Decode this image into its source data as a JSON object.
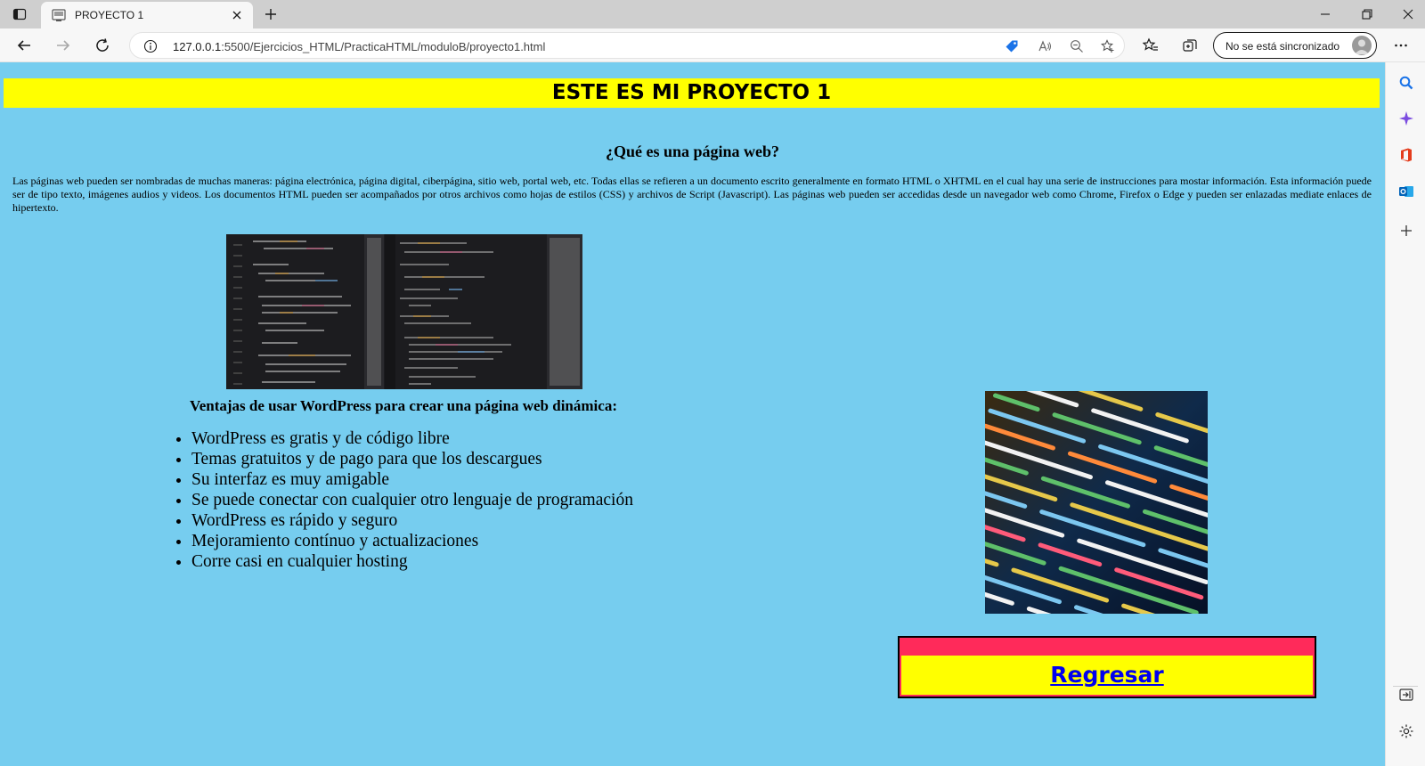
{
  "browser": {
    "tab": {
      "title": "PROYECTO 1"
    },
    "address": {
      "host": "127.0.0.1",
      "path": ":5500/Ejercicios_HTML/PracticaHTML/moduloB/proyecto1.html"
    },
    "sync_button": {
      "label": "No se está sincronizado"
    },
    "icons": {
      "sidebar_toggle": "sidebar-toggle-icon",
      "favicon": "page-favicon-icon",
      "close_tab": "close-icon",
      "new_tab": "plus-icon",
      "minimize": "minimize-icon",
      "restore": "restore-icon",
      "close_window": "close-icon",
      "back": "arrow-left-icon",
      "forward": "arrow-right-icon",
      "refresh": "refresh-icon",
      "site_info": "info-icon",
      "shopping": "tag-icon",
      "read_aloud": "read-aloud-icon",
      "zoom": "zoom-out-icon",
      "add_favorite": "star-plus-icon",
      "favorites": "favorites-icon",
      "collections": "collections-icon",
      "more": "more-icon"
    }
  },
  "edge_sidebar": {
    "icons": [
      "search-icon",
      "copilot-icon",
      "office-icon",
      "outlook-icon",
      "plus-icon",
      "sidebar-expand-icon",
      "settings-icon"
    ]
  },
  "page": {
    "heading": "ESTE ES MI PROYECTO 1",
    "section_title": "¿Qué es una página web?",
    "intro": "Las páginas web pueden ser nombradas de muchas maneras: página electrónica, página digital, ciberpágina, sitio web, portal web, etc. Todas ellas se refieren a un documento escrito generalmente en formato HTML o XHTML en el cual hay una serie de instrucciones para mostar información. Esta información puede ser de tipo texto, imágenes audios y videos. Los documentos HTML pueden ser acompañados por otros archivos como hojas de estilos (CSS) y archivos de Script (Javascript). Las páginas web pueden ser accedidas desde un navegador web como Chrome, Firefox o Edge y pueden ser enlazadas mediate enlaces de hipertexto.",
    "advantages_title": "Ventajas de usar WordPress para crear una página web dinámica:",
    "advantages": [
      "WordPress es gratis y de código libre",
      "Temas gratuitos y de pago para que los descargues",
      "Su interfaz es muy amigable",
      "Se puede conectar con cualquier otro lenguaje de programación",
      "WordPress es rápido y seguro",
      "Mejoramiento contínuo y actualizaciones",
      "Corre casi en cualquier hosting"
    ],
    "back_link": "Regresar",
    "colors": {
      "background": "#76cdef",
      "banner": "#ffff00",
      "back_box_border": "#ff2a5a",
      "link": "#0000ee"
    }
  }
}
